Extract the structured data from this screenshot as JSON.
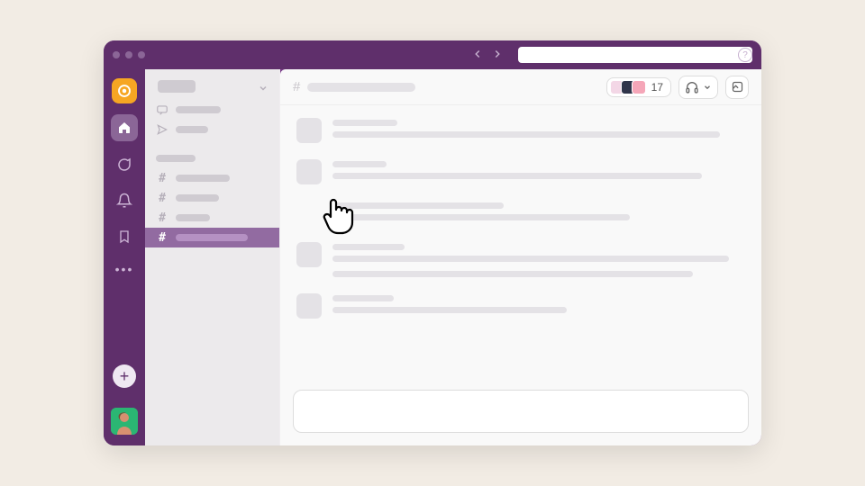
{
  "colors": {
    "brand": "#5f2f6b",
    "brand_light": "#783b87",
    "workspace_accent": "#f6a623",
    "selected_channel": "#926ba1",
    "user_avatar_bg": "#2bb673"
  },
  "rail": {
    "workspace_icon": "slack-workspace-icon",
    "items": [
      {
        "name": "home",
        "active": true
      },
      {
        "name": "dm"
      },
      {
        "name": "activity"
      },
      {
        "name": "later"
      }
    ],
    "more_label": "•••",
    "add_label": "+"
  },
  "sidebar": {
    "sections": [
      {
        "icon": "chat-icon"
      },
      {
        "icon": "send-icon"
      }
    ],
    "channels_prefix": "#"
  },
  "channel_header": {
    "hash": "#",
    "member_count": "17",
    "huddle_label": "",
    "member_avatars": [
      {
        "bg": "#f3d7e6"
      },
      {
        "bg": "#30344a"
      },
      {
        "bg": "#f5a6b8"
      }
    ]
  }
}
